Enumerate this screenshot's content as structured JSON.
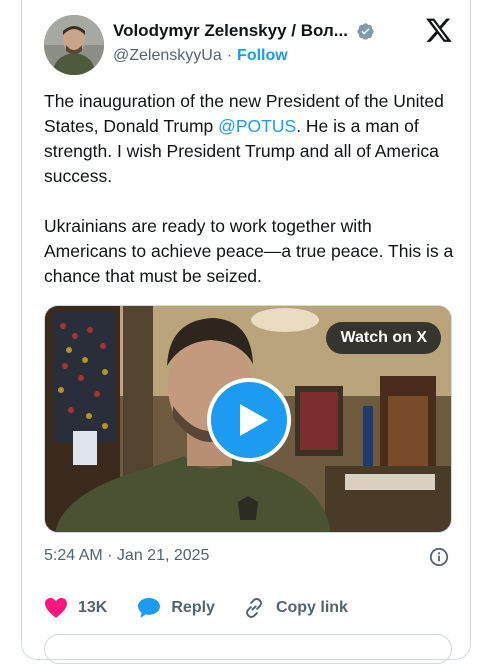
{
  "author": {
    "display_name": "Volodymyr Zelenskyy / Вол...",
    "handle": "@ZelenskyyUa",
    "separator": "·",
    "follow_label": "Follow"
  },
  "tweet": {
    "paragraph_1_prefix": "The inauguration of the new President of the United States, Donald Trump ",
    "mention": "@POTUS",
    "paragraph_1_suffix": ". He is a man of strength. I wish President Trump and all of America success.",
    "paragraph_2": "Ukrainians are ready to work together with Americans to achieve peace—a true peace. This is a chance that must be seized."
  },
  "media": {
    "watch_label": "Watch on X"
  },
  "meta": {
    "timestamp": "5:24 AM · Jan 21, 2025"
  },
  "actions": {
    "likes_count": "13K",
    "reply_label": "Reply",
    "copy_link_label": "Copy link"
  },
  "colors": {
    "accent": "#1d9bf0",
    "like": "#f91880",
    "text": "#0f1419",
    "secondary": "#536471"
  },
  "icons": [
    "verified-badge-icon",
    "x-logo-icon",
    "play-icon",
    "info-icon",
    "heart-icon",
    "reply-bubble-icon",
    "link-icon"
  ]
}
